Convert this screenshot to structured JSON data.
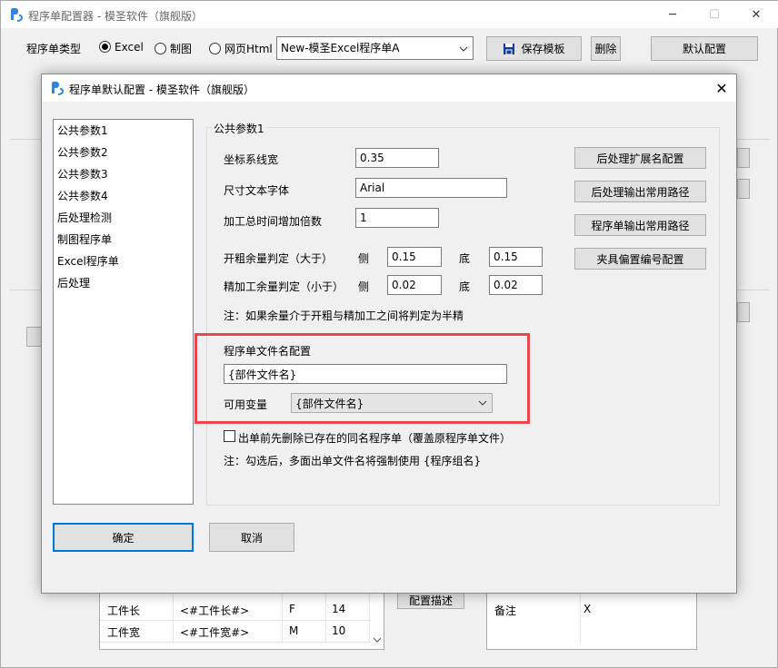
{
  "main_window": {
    "title": "程序单配置器 - 模圣软件（旗舰版）",
    "type_label": "程序单类型",
    "radios": [
      {
        "label": "Excel",
        "checked": true
      },
      {
        "label": "制图",
        "checked": false
      },
      {
        "label": "网页Html",
        "checked": false
      }
    ],
    "template_selected": "New-模圣Excel程序单A",
    "save_template": "保存模板",
    "delete": "删除",
    "default_config": "默认配置",
    "config_desc": "配置描述",
    "table_rows": [
      {
        "name": "工件长",
        "var": "<#工件长#>",
        "code": "F",
        "value": "14"
      },
      {
        "name": "工件宽",
        "var": "<#工件宽#>",
        "code": "M",
        "value": "10"
      }
    ],
    "right_table_row": {
      "name": "备注",
      "value": "X"
    }
  },
  "dialog": {
    "title": "程序单默认配置 - 模圣软件（旗舰版）",
    "nav_items": [
      "公共参数1",
      "公共参数2",
      "公共参数3",
      "公共参数4",
      "后处理检测",
      "制图程序单",
      "Excel程序单",
      "后处理"
    ],
    "group_title": "公共参数1",
    "coord_width_label": "坐标系线宽",
    "coord_width_value": "0.35",
    "dim_font_label": "尺寸文本字体",
    "dim_font_value": "Arial",
    "time_factor_label": "加工总时间增加倍数",
    "time_factor_value": "1",
    "rough_label": "开粗余量判定（大于）",
    "finish_label": "精加工余量判定（小于）",
    "side_label": "侧",
    "bottom_label": "底",
    "rough_side": "0.15",
    "rough_bottom": "0.15",
    "finish_side": "0.02",
    "finish_bottom": "0.02",
    "note1": "注：如果余量介于开粗与精加工之间将判定为半精",
    "filename_label": "程序单文件名配置",
    "filename_value": "{部件文件名}",
    "vars_label": "可用变量",
    "vars_selected": "{部件文件名}",
    "delete_checkbox": "出单前先删除已存在的同名程序单（覆盖原程序单文件）",
    "note2": "注：勾选后，多面出单文件名将强制使用 {程序组名}",
    "buttons": [
      "后处理扩展名配置",
      "后处理输出常用路径",
      "程序单输出常用路径",
      "夹具偏置编号配置"
    ],
    "ok": "确定",
    "cancel": "取消"
  },
  "colors": {
    "highlight": "#e8474e",
    "accent": "#0078d7",
    "logo": "#2e86de"
  }
}
